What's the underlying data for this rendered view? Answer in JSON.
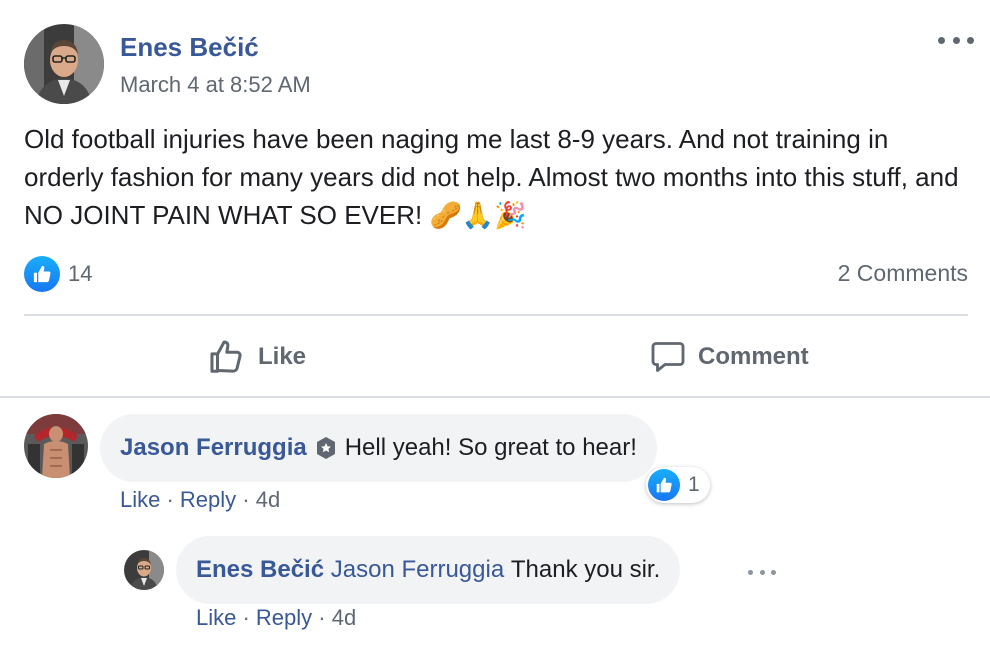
{
  "post": {
    "author": "Enes Bečić",
    "timestamp": "March 4 at 8:52 AM",
    "text": "Old football injuries have been naging me last 8-9 years. And not training in orderly fashion for many years did not help. Almost two months into this stuff, and NO JOINT PAIN WHAT SO EVER! 🥜🙏🎉",
    "reaction_count": "14",
    "comment_count": "2 Comments"
  },
  "actions": {
    "like_label": "Like",
    "comment_label": "Comment"
  },
  "comments": [
    {
      "author": "Jason Ferruggia",
      "text": "Hell yeah! So great to hear!",
      "reaction_count": "1",
      "like_label": "Like",
      "reply_label": "Reply",
      "age": "4d"
    }
  ],
  "reply": {
    "author": "Enes Bečić",
    "mention": "Jason Ferruggia",
    "text": "Thank you sir.",
    "like_label": "Like",
    "reply_label": "Reply",
    "age": "4d"
  },
  "icons": {
    "more": "more-horizontal-icon",
    "like_reaction": "thumbs-up-icon",
    "like_action": "thumbs-up-outline-icon",
    "comment_action": "speech-bubble-icon",
    "badge": "top-fan-badge-icon"
  },
  "colors": {
    "link_blue": "#385898",
    "muted_gray": "#606770",
    "bubble_bg": "#f2f3f5",
    "like_blue": "#1877f2"
  }
}
